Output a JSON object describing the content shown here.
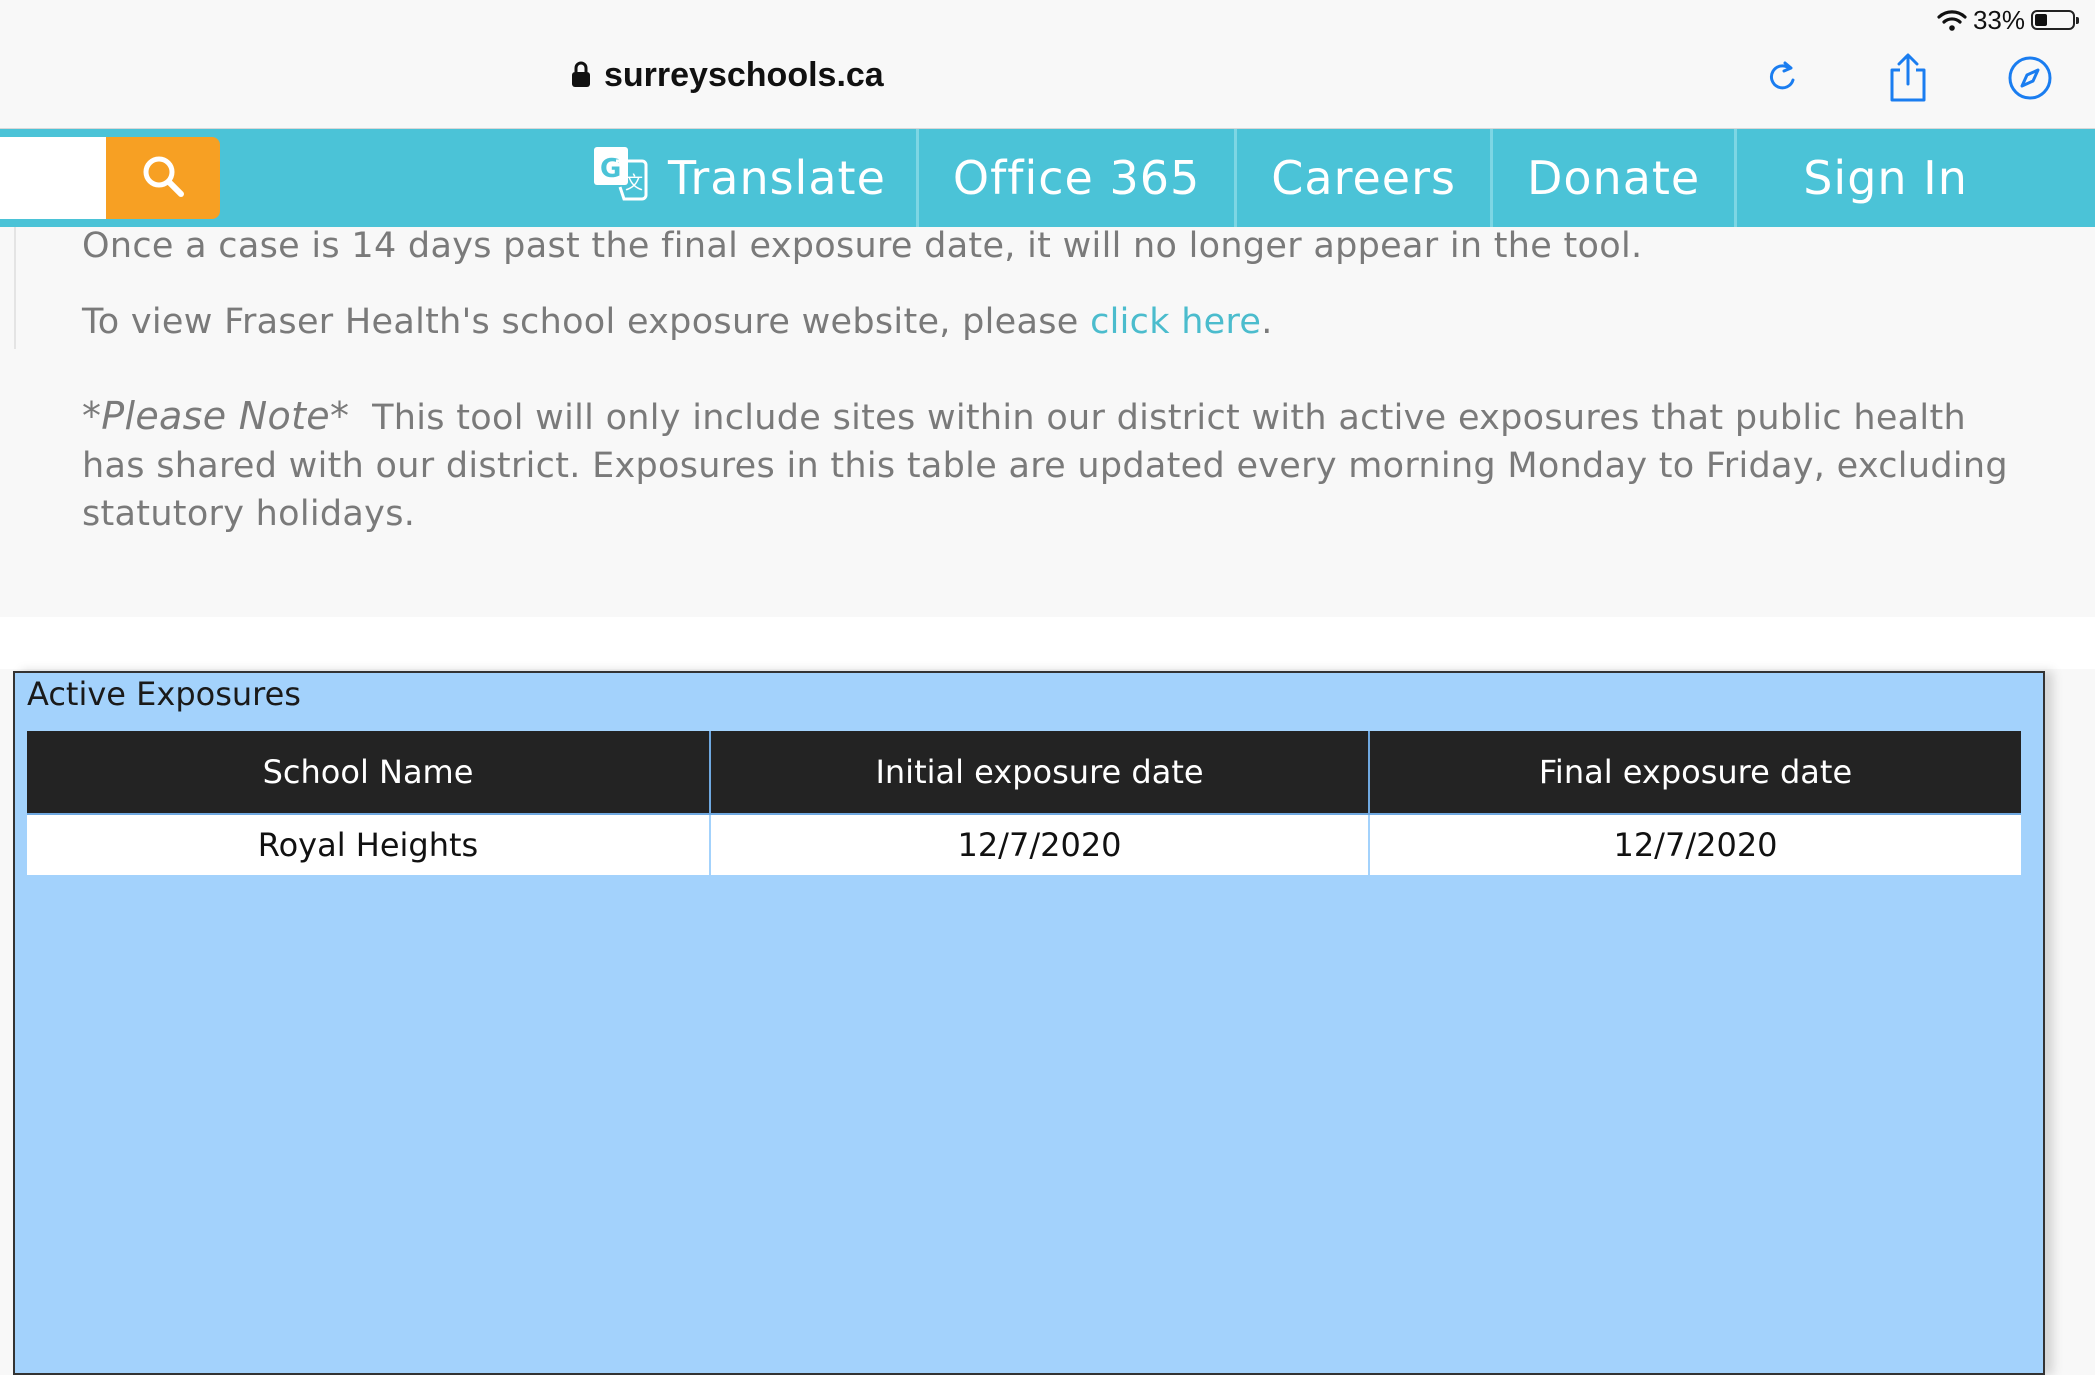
{
  "status_bar": {
    "battery_text": "33%",
    "battery_level": 0.33
  },
  "browser": {
    "url": "surreyschools.ca",
    "icons": {
      "lock": "lock-icon",
      "reload": "reload-icon",
      "share": "share-icon",
      "compass": "compass-icon"
    }
  },
  "site_nav": {
    "search_placeholder": "",
    "items": [
      {
        "label": "Translate"
      },
      {
        "label": "Office 365"
      },
      {
        "label": "Careers"
      },
      {
        "label": "Donate"
      },
      {
        "label": "Sign In"
      }
    ]
  },
  "content": {
    "para1": "Once a case is 14 days past the final exposure date, it will no longer appear in the tool.",
    "para2_prefix": "To view Fraser Health's school exposure website, please ",
    "para2_link": "click here",
    "para2_suffix": ".",
    "note_label": "*Please Note*",
    "note_text": "This tool will only include sites within our district with active exposures that public health has shared with our district. Exposures in this table are updated every morning Monday to Friday, excluding statutory holidays."
  },
  "report": {
    "title": "Active Exposures",
    "columns": [
      "School Name",
      "Initial exposure date",
      "Final exposure date"
    ],
    "rows": [
      [
        "Royal Heights",
        "12/7/2020",
        "12/7/2020"
      ]
    ]
  },
  "colors": {
    "nav_bg": "#4bc3d7",
    "search_button": "#f7a023",
    "link": "#4bbccd",
    "report_bg": "#a3d2fc",
    "table_header": "#232323",
    "browser_accent": "#1a7df0"
  }
}
